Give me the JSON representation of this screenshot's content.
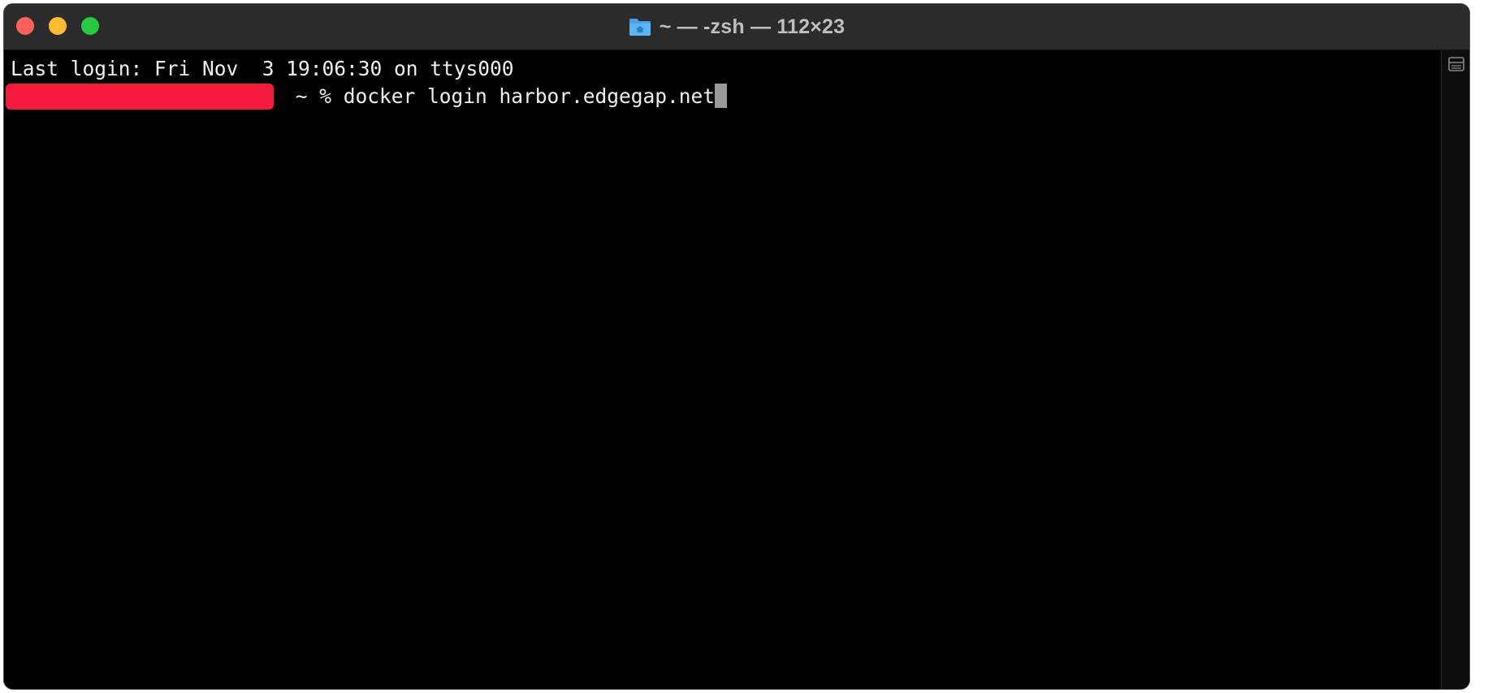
{
  "window": {
    "title": "~ — -zsh — 112×23",
    "title_icon": "home-folder-icon"
  },
  "terminal": {
    "line1": "Last login: Fri Nov  3 19:06:30 on ttys000",
    "prompt_suffix": " ~ % ",
    "command": "docker login harbor.edgegap.net"
  },
  "colors": {
    "background": "#000000",
    "text": "#f0f0f0",
    "redaction": "#f7193e",
    "close": "#fe5f57",
    "minimize": "#febc2e",
    "zoom": "#28c840"
  }
}
